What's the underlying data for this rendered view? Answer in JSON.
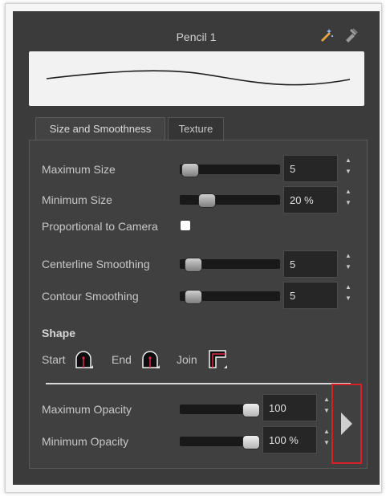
{
  "window": {
    "title": "Pencil 1"
  },
  "tabs": [
    "Size and Smoothness",
    "Texture"
  ],
  "size_smoothness": {
    "maximum_size": {
      "label": "Maximum Size",
      "value": "5"
    },
    "minimum_size": {
      "label": "Minimum Size",
      "value": "20 %"
    },
    "proportional_to_camera": {
      "label": "Proportional to Camera",
      "checked": false
    },
    "centerline_smoothing": {
      "label": "Centerline Smoothing",
      "value": "5"
    },
    "contour_smoothing": {
      "label": "Contour Smoothing",
      "value": "5"
    }
  },
  "shape": {
    "heading": "Shape",
    "start_label": "Start",
    "end_label": "End",
    "join_label": "Join"
  },
  "opacity": {
    "maximum": {
      "label": "Maximum Opacity",
      "value": "100"
    },
    "minimum": {
      "label": "Minimum Opacity",
      "value": "100 %"
    }
  },
  "icons": {
    "new_preset": "wand-sparkle-icon",
    "delete_preset": "brush-delete-icon",
    "expand": "play-triangle-icon"
  },
  "colors": {
    "panel_bg": "#3b3b3b",
    "highlight_box": "#d91f26",
    "shape_accent": "#e0294a"
  }
}
